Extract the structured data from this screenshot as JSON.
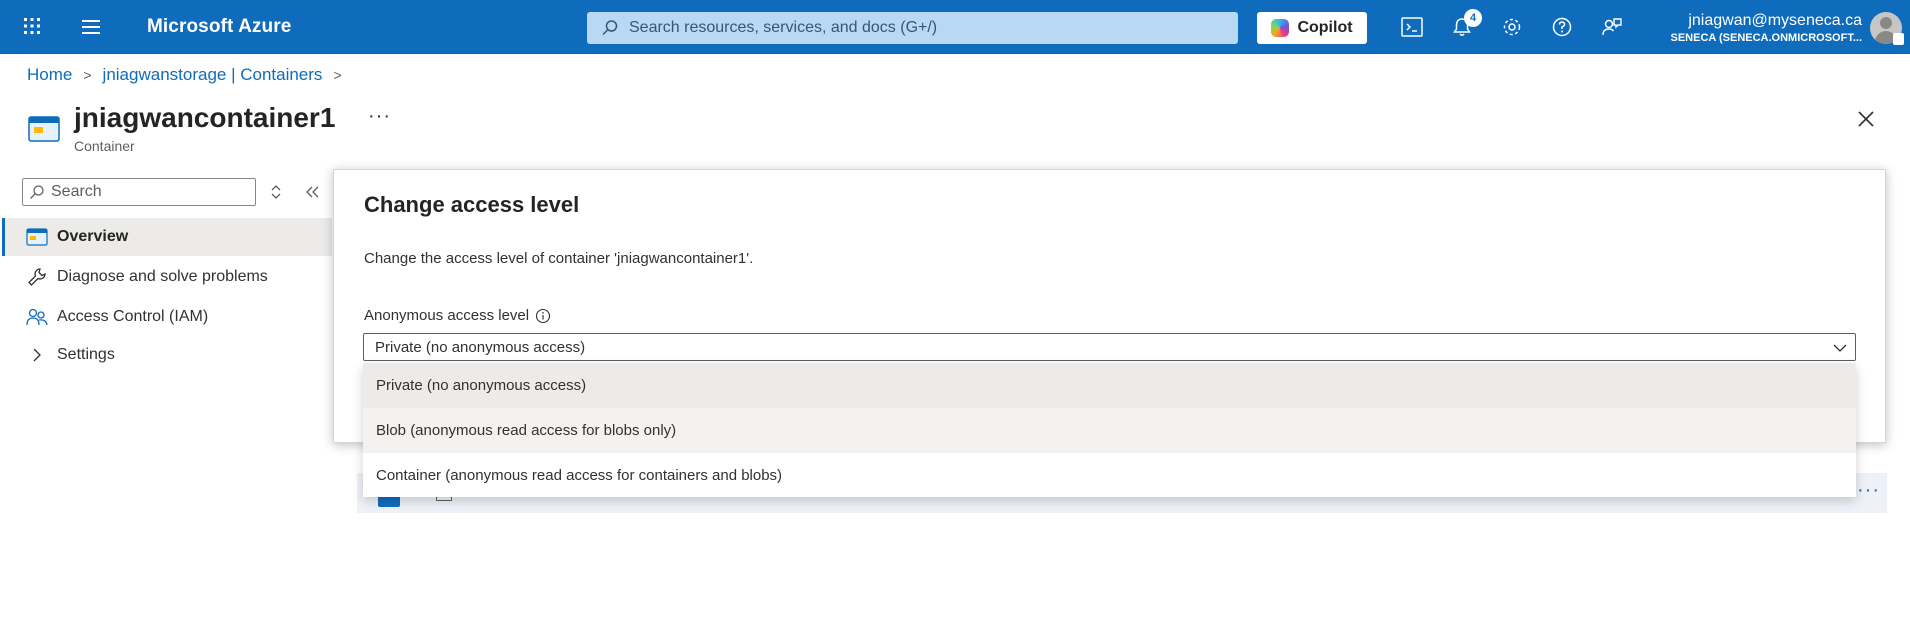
{
  "topbar": {
    "brand": "Microsoft Azure",
    "search_placeholder": "Search resources, services, and docs (G+/)",
    "copilot_label": "Copilot",
    "notifications_count": "4",
    "user_email": "jniagwan@myseneca.ca",
    "user_org": "SENECA (SENECA.ONMICROSOFT...",
    "icons": [
      "waffle-icon",
      "hamburger-icon",
      "search-icon",
      "cloud-shell-icon",
      "bell-icon",
      "gear-icon",
      "help-icon",
      "feedback-icon"
    ]
  },
  "breadcrumb": {
    "items": [
      "Home",
      "jniagwanstorage | Containers"
    ]
  },
  "page": {
    "title": "jniagwancontainer1",
    "subtitle": "Container",
    "more": "···"
  },
  "nav": {
    "search_placeholder": "Search",
    "items": [
      {
        "label": "Overview",
        "icon": "container-icon",
        "active": true
      },
      {
        "label": "Diagnose and solve problems",
        "icon": "wrench-icon"
      },
      {
        "label": "Access Control (IAM)",
        "icon": "people-icon"
      },
      {
        "label": "Settings",
        "icon": "chevron-right-icon"
      }
    ]
  },
  "panel": {
    "title": "Change access level",
    "description": "Change the access level of container 'jniagwancontainer1'.",
    "field_label": "Anonymous access level",
    "selected_value": "Private (no anonymous access)",
    "options": [
      "Private (no anonymous access)",
      "Blob (anonymous read access for blobs only)",
      "Container (anonymous read access for containers and blobs)"
    ]
  },
  "colors": {
    "accent": "#0f6cbd",
    "topbar_search": "#b8d8f4",
    "selected_bg": "#edebe9"
  }
}
